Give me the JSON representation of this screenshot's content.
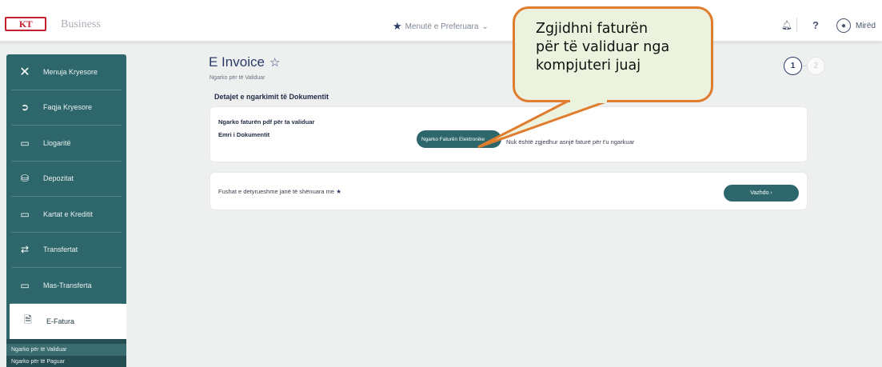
{
  "header": {
    "logo_text": "KT",
    "brand": "Business",
    "favorites_label": "Menutë e Preferuara",
    "help_label": "?",
    "user_greeting": "Mirëd"
  },
  "sidebar": {
    "title": "Menuja Kryesore",
    "items": [
      {
        "label": "Faqja Kryesore",
        "icon": "home-icon"
      },
      {
        "label": "Llogaritë",
        "icon": "card-icon"
      },
      {
        "label": "Depozitat",
        "icon": "deposit-icon"
      },
      {
        "label": "Kartat e Kreditit",
        "icon": "credit-card-icon"
      },
      {
        "label": "Transfertat",
        "icon": "transfer-icon"
      },
      {
        "label": "Mas-Transferta",
        "icon": "mass-transfer-icon"
      },
      {
        "label": "E-Fatura",
        "icon": "invoice-icon"
      }
    ],
    "submenu": [
      "Ngarko për të Validuar",
      "Ngarko për të Paguar"
    ]
  },
  "main": {
    "title": "E Invoice",
    "subtitle": "Ngarko për të Validuar",
    "steps": [
      "1",
      "2"
    ],
    "section_title": "Detajet e ngarkimit të Dokumentit",
    "upload_label": "Ngarko faturën pdf për ta validuar",
    "doc_name_label": "Emri i Dokumentit",
    "upload_button": "Ngarko Faturën Elektronike",
    "no_file_text": "Nuk është zgjedhur asnjë faturë për t'u ngarkuar",
    "required_text": "Fushat e detyrueshme janë të shënuara me",
    "next_button": "Vazhdo ›"
  },
  "callout": {
    "line1": "Zgjidhni faturën",
    "line2": "për të validuar nga",
    "line3": "kompjuteri juaj"
  },
  "colors": {
    "sidebar": "#2e676b",
    "accent": "#2a3a66",
    "callout_border": "#e07c2d",
    "callout_fill": "#ebf2dd",
    "logo_red": "#c41f2f"
  }
}
